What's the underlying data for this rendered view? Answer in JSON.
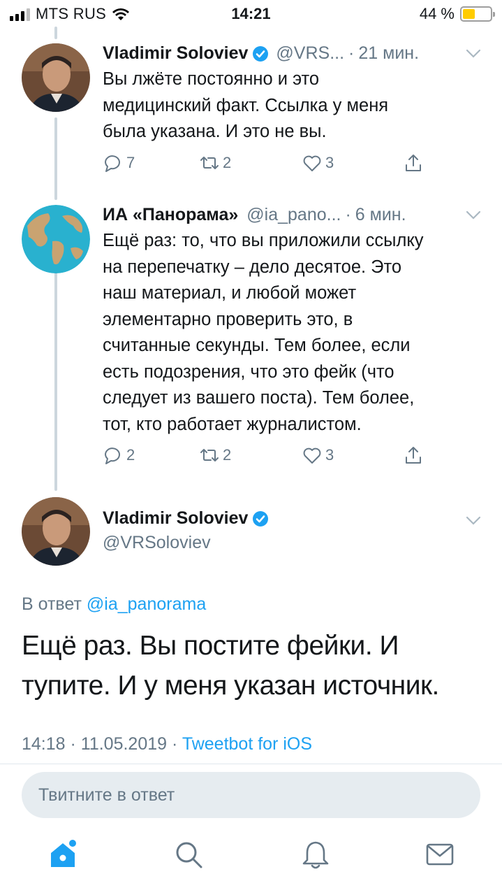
{
  "status_bar": {
    "carrier": "MTS RUS",
    "time": "14:21",
    "battery": "44 %",
    "battery_level": 0.44
  },
  "thread": [
    {
      "name": "Vladimir Soloviev",
      "verified": true,
      "handle": "@VRS...",
      "time": "21 мин.",
      "text": "Вы лжёте постоянно и это медицинский факт. Ссылка у меня была указана. И это не вы.",
      "lines": [
        "Вы лжёте постоянно и это",
        "медицинский факт. Ссылка у меня",
        "была указана. И это не вы."
      ],
      "replies": "7",
      "retweets": "2",
      "likes": "3"
    },
    {
      "name": "ИА «Панорама»",
      "verified": false,
      "handle": "@ia_pano...",
      "time": "6 мин.",
      "lines": [
        "Ещё раз: то, что вы приложили ссылку",
        "на перепечатку – дело десятое. Это",
        "наш материал, и любой может",
        "элементарно проверить это, в",
        "считанные секунды. Тем более, если",
        "есть подозрения, что это фейк (что",
        "следует из вашего поста). Тем более,",
        "тот, кто работает журналистом."
      ],
      "replies": "2",
      "retweets": "2",
      "likes": "3"
    }
  ],
  "main_tweet": {
    "name": "Vladimir Soloviev",
    "handle": "@VRSoloviev",
    "reply_prefix": "В ответ",
    "reply_to": "@ia_panorama",
    "lines": [
      "Ещё раз. Вы постите фейки. И",
      "тупите. И у меня указан источник."
    ],
    "timestamp": "14:18 · 11.05.2019 ·",
    "source": "Tweetbot for iOS"
  },
  "reply_box": {
    "placeholder": "Твитните в ответ"
  },
  "tab_bar": {
    "tabs": [
      "home-icon",
      "search-icon",
      "bell-icon",
      "mail-icon"
    ],
    "active": "home-icon"
  },
  "colors": {
    "accent": "#1da1f2",
    "muted": "#657786",
    "text": "#14171a",
    "battery": "#ffcc00"
  }
}
